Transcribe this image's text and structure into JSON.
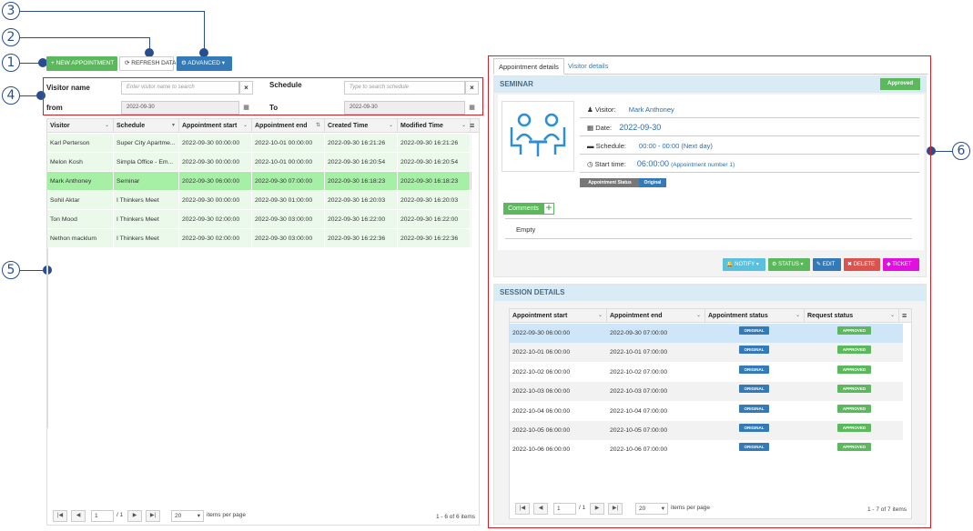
{
  "callouts": [
    "1",
    "2",
    "3",
    "4",
    "5",
    "6"
  ],
  "toolbar": {
    "new_appointment": "NEW APPOINTMENT",
    "refresh": "REFRESH DATA",
    "advanced": "ADVANCED",
    "plus_glyph": "+",
    "refresh_glyph": "⟳",
    "gear_glyph": "⚙",
    "caret_glyph": "▾"
  },
  "filters": {
    "visitor_label": "Visitor name",
    "visitor_placeholder": "Enter visitor name to search",
    "schedule_label": "Schedule",
    "schedule_placeholder": "Type to search schedule",
    "from_label": "from",
    "from_value": "2022-09-30",
    "to_label": "To",
    "to_value": "2022-09-30",
    "clear_glyph": "×",
    "calendar_glyph": "▦"
  },
  "grid": {
    "columns": [
      "Visitor",
      "Schedule",
      "Appointment start",
      "Appointment end",
      "Created Time",
      "Modified Time"
    ],
    "column_arrows": [
      "⌄",
      "▾",
      "⌄",
      "⇅",
      "⌄",
      "⌄"
    ],
    "menu_glyph": "≡",
    "rows": [
      [
        "Karl Perterson",
        "Super City Apartme...",
        "2022-09-30 00:00:00",
        "2022-10-01 00:00:00",
        "2022-09-30 16:21:26",
        "2022-09-30 16:21:26"
      ],
      [
        "Melon Kosh",
        "Simpla Office - Em...",
        "2022-09-30 00:00:00",
        "2022-10-01 00:00:00",
        "2022-09-30 16:20:54",
        "2022-09-30 16:20:54"
      ],
      [
        "Mark Anthoney",
        "Seminar",
        "2022-09-30 06:00:00",
        "2022-09-30 07:00:00",
        "2022-09-30 16:18:23",
        "2022-09-30 16:18:23"
      ],
      [
        "Sohil Aktar",
        "I Thinkers Meet",
        "2022-09-30 00:00:00",
        "2022-09-30 01:00:00",
        "2022-09-30 16:20:03",
        "2022-09-30 16:20:03"
      ],
      [
        "Ton Mood",
        "I Thinkers Meet",
        "2022-09-30 02:00:00",
        "2022-09-30 03:00:00",
        "2022-09-30 16:22:00",
        "2022-09-30 16:22:00"
      ],
      [
        "Nethon macklum",
        "I Thinkers Meet",
        "2022-09-30 02:00:00",
        "2022-09-30 03:00:00",
        "2022-09-30 16:22:36",
        "2022-09-30 16:22:36"
      ]
    ],
    "selected_row": 2,
    "pager": {
      "first": "|◀",
      "prev": "◀",
      "next": "▶",
      "last": "▶|",
      "page": "1",
      "of": "/ 1",
      "per_page": "20",
      "per_page_caret": "▾",
      "per_page_label": "items per page",
      "summary": "1 - 6 of 6 items"
    }
  },
  "details": {
    "tab_active": "Appointment details",
    "tab_other": "Visitor details",
    "title": "SEMINAR",
    "status_badge": "Approved",
    "visitor_label": "Visitor:",
    "visitor_value": "Mark Anthoney",
    "date_label": "Date:",
    "date_value": "2022-09-30",
    "schedule_label": "Schedule:",
    "schedule_value": "00:00 - 00:00 (Next day)",
    "start_label": "Start time:",
    "start_value": "06:00:00",
    "start_note": "(Appointment number 1)",
    "appt_status_label": "Appointment Status",
    "appt_status_value": "Original",
    "comments_label": "Comments",
    "comments_add": "+",
    "comments_text": "Empty",
    "icons": {
      "visitor": "♟",
      "date": "▦",
      "schedule": "▬",
      "start": "◷"
    },
    "actions": {
      "notify": "NOTIFY ▾",
      "status": "STATUS ▾",
      "edit": "EDIT",
      "delete": "DELETE",
      "ticket": "TICKET",
      "notify_glyph": "🔔",
      "status_glyph": "⚙",
      "edit_glyph": "✎",
      "delete_glyph": "✖",
      "ticket_glyph": "◆"
    }
  },
  "session": {
    "title": "SESSION DETAILS",
    "columns": [
      "Appointment start",
      "Appointment end",
      "Appointment status",
      "Request status"
    ],
    "column_arrows": [
      "⌄",
      "⌄",
      "⌄",
      "⌄"
    ],
    "menu_glyph": "≡",
    "rows": [
      [
        "2022-09-30 06:00:00",
        "2022-09-30 07:00:00",
        "ORIGINAL",
        "APPROVED"
      ],
      [
        "2022-10-01 06:00:00",
        "2022-10-01 07:00:00",
        "ORIGINAL",
        "APPROVED"
      ],
      [
        "2022-10-02 06:00:00",
        "2022-10-02 07:00:00",
        "ORIGINAL",
        "APPROVED"
      ],
      [
        "2022-10-03 06:00:00",
        "2022-10-03 07:00:00",
        "ORIGINAL",
        "APPROVED"
      ],
      [
        "2022-10-04 06:00:00",
        "2022-10-04 07:00:00",
        "ORIGINAL",
        "APPROVED"
      ],
      [
        "2022-10-05 06:00:00",
        "2022-10-05 07:00:00",
        "ORIGINAL",
        "APPROVED"
      ],
      [
        "2022-10-06 06:00:00",
        "2022-10-06 07:00:00",
        "ORIGINAL",
        "APPROVED"
      ]
    ],
    "pager": {
      "first": "|◀",
      "prev": "◀",
      "next": "▶",
      "last": "▶|",
      "page": "1",
      "of": "/ 1",
      "per_page": "20",
      "per_page_caret": "▾",
      "per_page_label": "items per page",
      "summary": "1 - 7 of 7 items"
    }
  },
  "colors": {
    "green": "#5cb85c",
    "blue": "#337ab7",
    "red": "#d0202a",
    "callout": "#2a4d8f",
    "selected_row": "#a6f0a6",
    "row": "#eaf9ea",
    "approved": "#5cb85c",
    "original": "#337ab7",
    "notify": "#5bc0de",
    "delete": "#d9534f",
    "ticket": "#e010e0"
  }
}
